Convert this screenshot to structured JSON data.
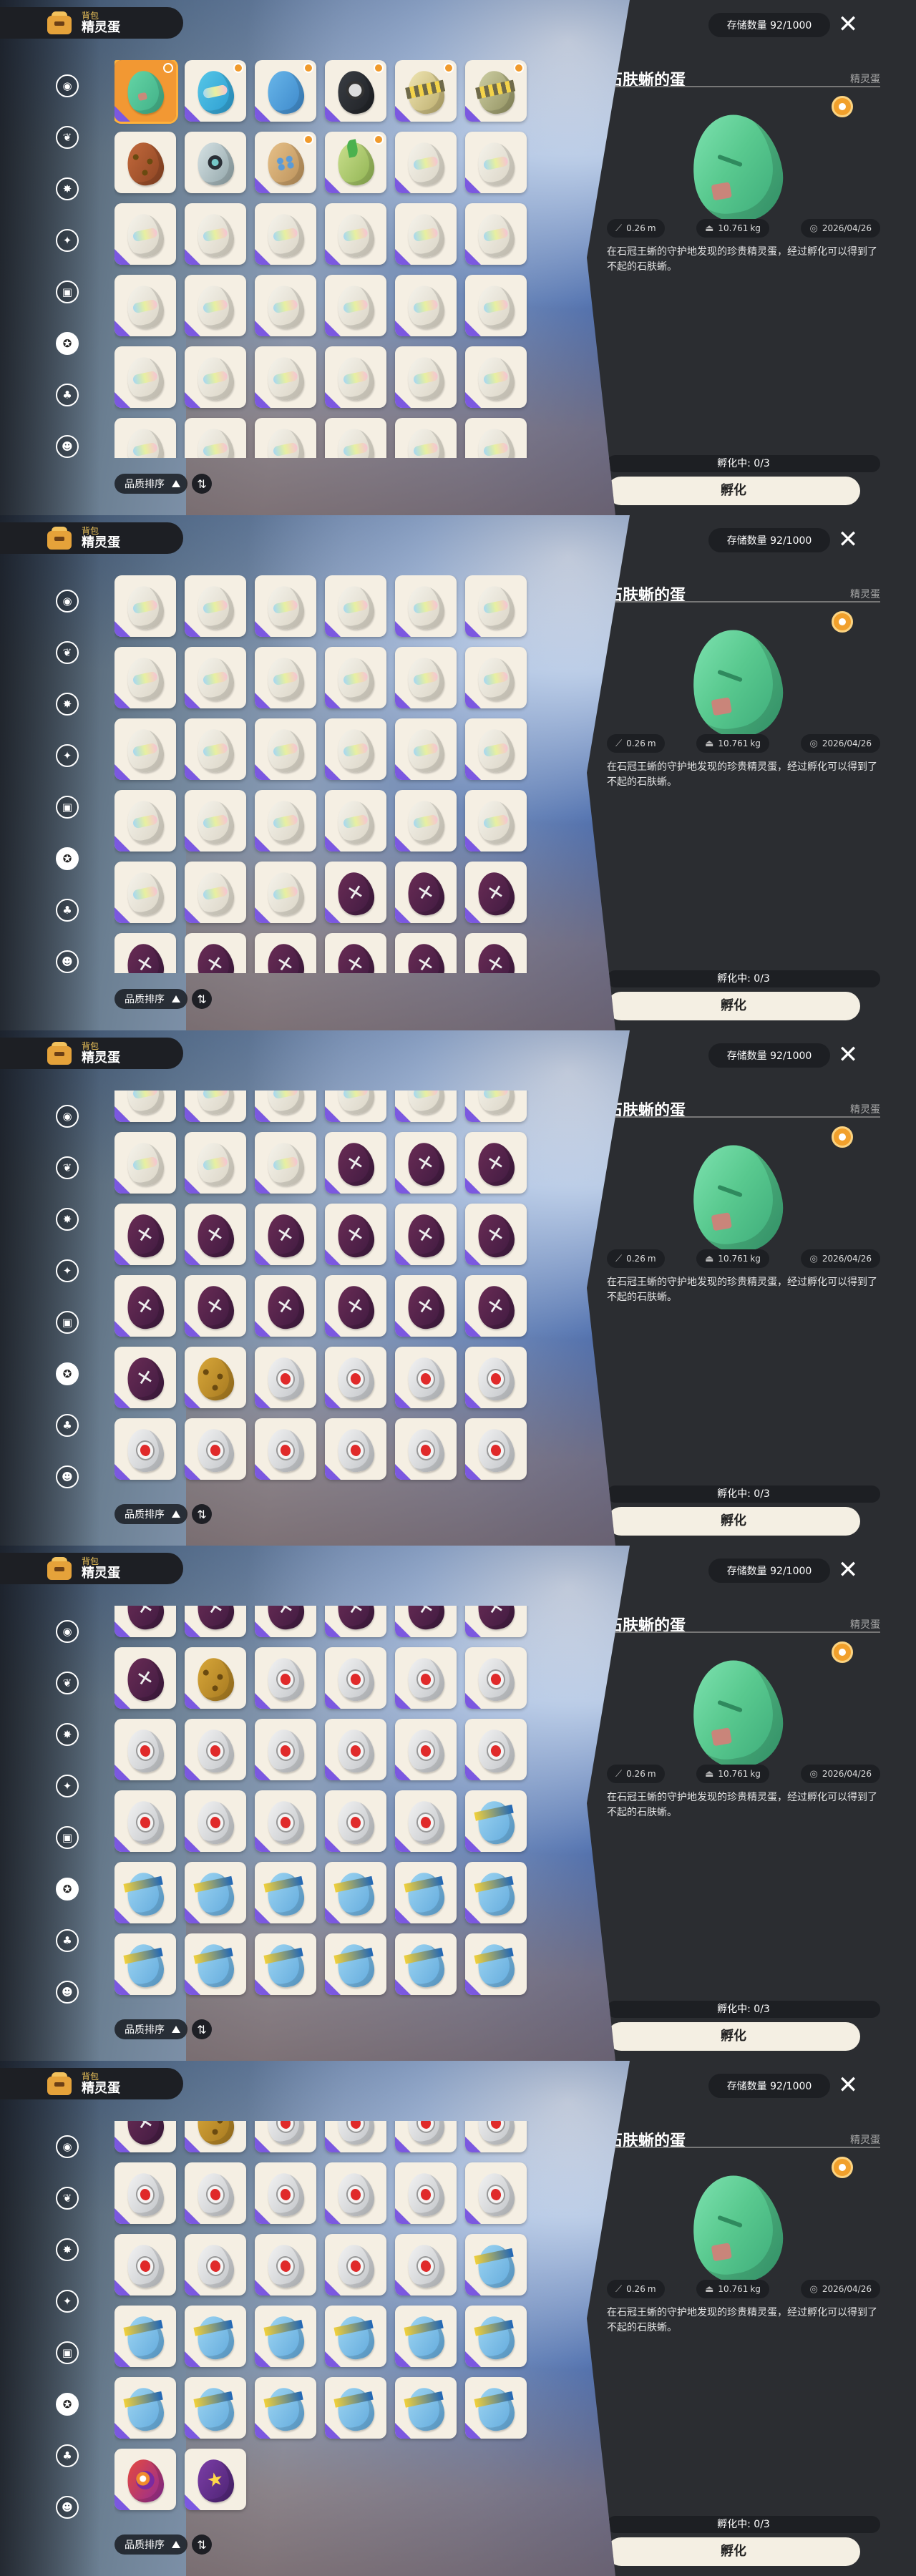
{
  "header": {
    "subtitle": "背包",
    "title": "精灵蛋"
  },
  "side_categories": [
    {
      "icon": "ball-icon",
      "glyph": "◉"
    },
    {
      "icon": "leaf-icon",
      "glyph": "❦"
    },
    {
      "icon": "spike-icon",
      "glyph": "✸"
    },
    {
      "icon": "bird-icon",
      "glyph": "✦"
    },
    {
      "icon": "cup-icon",
      "glyph": "▣"
    },
    {
      "icon": "egg-ball-icon",
      "glyph": "✪",
      "active": true
    },
    {
      "icon": "acorn-icon",
      "glyph": "♣"
    },
    {
      "icon": "mask-icon",
      "glyph": "☻"
    }
  ],
  "sort": {
    "label": "品质排序"
  },
  "detail": {
    "storage": "存储数量 92/1000",
    "close_glyph": "✕",
    "name": "石肤蜥的蛋",
    "type": "精灵蛋",
    "size": "0.26",
    "size_unit": "m",
    "weight": "10.761",
    "weight_unit": "kg",
    "date": "2026/04/26",
    "description": "在石冠王蜥的守护地发现的珍贵精灵蛋，经过孵化可以得到了不起的石肤蜥。",
    "hatch_status": "孵化中: 0/3",
    "hatch_button": "孵化"
  },
  "panels": [
    {
      "scroll": 0,
      "rows": [
        [
          "teal:sel",
          "blue-gem:b",
          "gem:b",
          "dark:b",
          "stripe:b",
          "olive:b"
        ],
        [
          "gold-spot",
          "ring",
          "seed:b",
          "leaf:b",
          "rainbow:c",
          "rainbow:c"
        ],
        [
          "rainbow:c",
          "rainbow:c",
          "rainbow:c",
          "rainbow:c",
          "rainbow:c",
          "rainbow:c"
        ],
        [
          "rainbow:c",
          "rainbow:c",
          "rainbow:c",
          "rainbow:c",
          "rainbow:c",
          "rainbow:c"
        ],
        [
          "rainbow:c",
          "rainbow:c",
          "rainbow:c",
          "rainbow:c",
          "rainbow:c",
          "rainbow:c"
        ],
        [
          "rainbow:c",
          "rainbow:c",
          "rainbow:c",
          "rainbow:c",
          "rainbow:c",
          "rainbow:c"
        ]
      ]
    },
    {
      "scroll": 0,
      "rows": [
        [
          "rainbow:c",
          "rainbow:c",
          "rainbow:c",
          "rainbow:c",
          "rainbow:c",
          "rainbow:c"
        ],
        [
          "rainbow:c",
          "rainbow:c",
          "rainbow:c",
          "rainbow:c",
          "rainbow:c",
          "rainbow:c"
        ],
        [
          "rainbow:c",
          "rainbow:c",
          "rainbow:c",
          "rainbow:c",
          "rainbow:c",
          "rainbow:c"
        ],
        [
          "rainbow:c",
          "rainbow:c",
          "rainbow:c",
          "rainbow:c",
          "rainbow:c",
          "rainbow:c"
        ],
        [
          "rainbow:c",
          "rainbow:c",
          "rainbow:c",
          "purple:c",
          "purple:c",
          "purple:c"
        ],
        [
          "purple:c",
          "purple:c",
          "purple:c",
          "purple:c",
          "purple:c",
          "purple:c"
        ]
      ]
    },
    {
      "scroll": -42,
      "rows": [
        [
          "rainbow:c",
          "rainbow:c",
          "rainbow:c",
          "rainbow:c",
          "rainbow:c",
          "rainbow:c"
        ],
        [
          "rainbow:c",
          "rainbow:c",
          "rainbow:c",
          "purple:c",
          "purple:c",
          "purple:c"
        ],
        [
          "purple:c",
          "purple:c",
          "purple:c",
          "purple:c",
          "purple:c",
          "purple:c"
        ],
        [
          "purple:c",
          "purple:c",
          "purple:c",
          "purple:c",
          "purple:c",
          "purple:c"
        ],
        [
          "purple:c",
          "gold:c",
          "white:c",
          "white:c",
          "white:c",
          "white:c"
        ],
        [
          "white:c",
          "white:c",
          "white:c",
          "white:c",
          "white:c",
          "white:c"
        ]
      ]
    },
    {
      "scroll": -42,
      "rows": [
        [
          "purple:c",
          "purple:c",
          "purple:c",
          "purple:c",
          "purple:c",
          "purple:c"
        ],
        [
          "purple:c",
          "gold:c",
          "white:c",
          "white:c",
          "white:c",
          "white:c"
        ],
        [
          "white:c",
          "white:c",
          "white:c",
          "white:c",
          "white:c",
          "white:c"
        ],
        [
          "white:c",
          "white:c",
          "white:c",
          "white:c",
          "white:c",
          "blue:c"
        ],
        [
          "blue:c",
          "blue:c",
          "blue:c",
          "blue:c",
          "blue:c",
          "blue:c"
        ],
        [
          "blue:c",
          "blue:c",
          "blue:c",
          "blue:c",
          "blue:c",
          "blue:c"
        ],
        [
          "white:c",
          "white:c"
        ]
      ]
    },
    {
      "scroll": -42,
      "rows": [
        [
          "purple:c",
          "gold:c",
          "white:c",
          "white:c",
          "white:c",
          "white:c"
        ],
        [
          "white:c",
          "white:c",
          "white:c",
          "white:c",
          "white:c",
          "white:c"
        ],
        [
          "white:c",
          "white:c",
          "white:c",
          "white:c",
          "white:c",
          "blue:c"
        ],
        [
          "blue:c",
          "blue:c",
          "blue:c",
          "blue:c",
          "blue:c",
          "blue:c"
        ],
        [
          "blue:c",
          "blue:c",
          "blue:c",
          "blue:c",
          "blue:c",
          "blue:c"
        ],
        [
          "orb:c",
          "star:c"
        ]
      ]
    }
  ]
}
